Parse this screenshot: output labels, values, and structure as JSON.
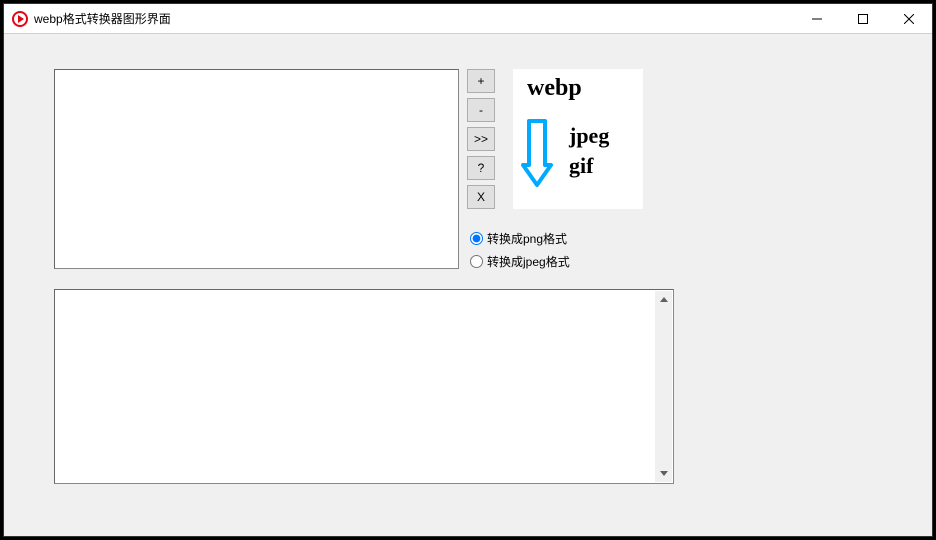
{
  "window": {
    "title": "webp格式转换器图形界面"
  },
  "buttons": {
    "add": "+",
    "remove": "-",
    "go": ">>",
    "help": "?",
    "clear": "X"
  },
  "logo": {
    "webp": "webp",
    "jpeg": "jpeg",
    "gif": "gif"
  },
  "radios": {
    "png": "转换成png格式",
    "jpeg": "转换成jpeg格式",
    "selected": "png"
  }
}
